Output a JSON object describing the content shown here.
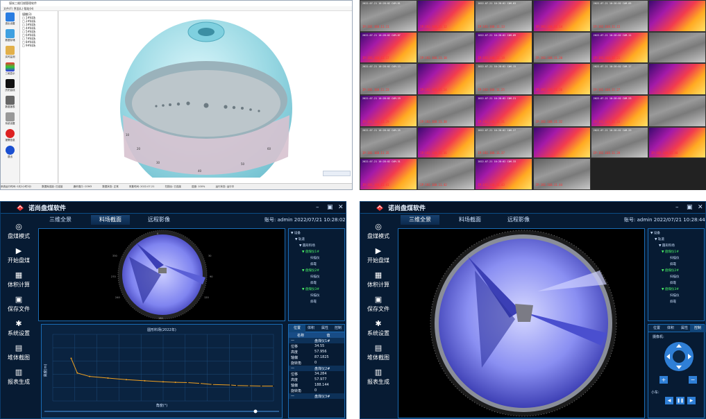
{
  "q1": {
    "window_title": "煤炭三维扫描管理软件",
    "menubar": "文件(F)  界面(L)  帮助(H)",
    "sidebar": [
      "退出设置",
      "数据存储",
      "实时监测",
      "三维显示",
      "历史曲线",
      "数据报表",
      "系统设置",
      "报警信息",
      "退出"
    ],
    "tree": [
      "煤棚(3)",
      "□ 1#料场",
      "□ 2#料场",
      "□ 3#料场",
      "□ 4#料场",
      "□ 5#料场",
      "□ 6#料场",
      "□ 7#料场",
      "□ 8#料场",
      "□ 9#料场"
    ],
    "status": [
      "系统运行时间: 0天2小时3分",
      "数据库连接: 已连接",
      "通讯端口: COM3",
      "数据状态: 正常",
      "采集时间: 2022-07-21",
      "扫描仪: 已连接",
      "进度: 100%",
      "运行状态: 运行中"
    ]
  },
  "q2": {
    "cells": [
      {
        "lab": "2022-07-21 10:28:02 CAM-01",
        "ip": "IP:192.168.11.11"
      },
      {
        "lab": "",
        "ip": "IP:192.168.11.12"
      },
      {
        "lab": "2022-07-21 10:28:02 CAM-03",
        "ip": "IP:192.168.11.13"
      },
      {
        "lab": "",
        "ip": "IP:192.168.11.14"
      },
      {
        "lab": "2022-07-21 10:28:02 CAM-05",
        "ip": "IP:192.168.11.15"
      },
      {
        "lab": "",
        "ip": ""
      },
      {
        "lab": "2022-07-21 10:28:02 CAM-07",
        "ip": "IP:192.168.11.17"
      },
      {
        "lab": "",
        "ip": "IP:192.168.11.18"
      },
      {
        "lab": "2022-07-21 10:28:02 CAM-09",
        "ip": "IP:192.168.11.19"
      },
      {
        "lab": "",
        "ip": "IP:192.168.11.20"
      },
      {
        "lab": "2022-07-21 10:28:02 CAM-11",
        "ip": "IP:192.168.11.21"
      },
      {
        "lab": "",
        "ip": ""
      },
      {
        "lab": "2022-07-21 10:28:02 CAM-13",
        "ip": "IP:192.168.11.23"
      },
      {
        "lab": "",
        "ip": "IP:192.168.11.24"
      },
      {
        "lab": "2022-07-21 10:28:02 CAM-15",
        "ip": "IP:192.168.11.25"
      },
      {
        "lab": "",
        "ip": "IP:192.168.11.26"
      },
      {
        "lab": "2022-07-21 10:28:02 CAM-17",
        "ip": "IP:192.168.11.27"
      },
      {
        "lab": "",
        "ip": ""
      },
      {
        "lab": "2022-07-21 10:28:02 CAM-19",
        "ip": "IP:192.168.11.29"
      },
      {
        "lab": "",
        "ip": "IP:192.168.11.30"
      },
      {
        "lab": "2022-07-21 10:28:02 CAM-21",
        "ip": "IP:192.168.11.31"
      },
      {
        "lab": "",
        "ip": "IP:192.168.11.32"
      },
      {
        "lab": "2022-07-21 10:28:02 CAM-23",
        "ip": "IP:192.168.11.33"
      },
      {
        "lab": "",
        "ip": ""
      },
      {
        "lab": "2022-07-21 10:28:02 CAM-25",
        "ip": "IP:192.168.11.35"
      },
      {
        "lab": "",
        "ip": "IP:192.168.11.36"
      },
      {
        "lab": "2022-07-21 10:28:02 CAM-27",
        "ip": "IP:192.168.11.37"
      },
      {
        "lab": "",
        "ip": ""
      },
      {
        "lab": "2022-07-21 10:28:02 CAM-29",
        "ip": "IP:192.168.11.39"
      },
      {
        "lab": "",
        "ip": "IP:192.168.11.40"
      },
      {
        "lab": "2022-07-21 10:28:02 CAM-31",
        "ip": "IP:192.168.11.41"
      },
      {
        "lab": "",
        "ip": "IP:192.168.11.42"
      },
      {
        "lab": "2022-07-21 10:28:02 CAM-33",
        "ip": "IP:192.168.11.43"
      },
      {
        "lab": "",
        "ip": "IP:192.168.11.44"
      }
    ]
  },
  "app": {
    "name": "诺尚盘煤软件",
    "menu": [
      "盘煤模式",
      "开始盘煤",
      "体积计算",
      "保存文件",
      "系统设置",
      "堆体截图",
      "报表生成"
    ],
    "tabs": [
      "三维全景",
      "料场截面",
      "远程影像"
    ],
    "account_left": "账号: admin 2022/07/21 10:28:02",
    "account_right": "账号: admin 2022/07/21 10:28:44",
    "tree": {
      "root": "设备",
      "l1": "轨道",
      "l2": "圆形料场",
      "groups": [
        {
          "name": "盘煤仪1#",
          "items": [
            "扫描仪",
            "斜靠"
          ]
        },
        {
          "name": "盘煤仪2#",
          "items": [
            "扫描仪",
            "斜靠"
          ]
        },
        {
          "name": "盘煤仪3#",
          "items": [
            "扫描仪",
            "斜靠"
          ]
        }
      ]
    },
    "ptabs": [
      "位置",
      "体积",
      "属性",
      "控制"
    ],
    "table_head": [
      "名称",
      "值"
    ],
    "rows": [
      {
        "k": "—",
        "v": "盘煤仪1#"
      },
      {
        "k": "位移",
        "v": "34.55"
      },
      {
        "k": "高度",
        "v": "57.956"
      },
      {
        "k": "轴偏",
        "v": "87.1825"
      },
      {
        "k": "旋转角",
        "v": "0"
      },
      {
        "k": "—",
        "v": "盘煤仪2#"
      },
      {
        "k": "位移",
        "v": "34.284"
      },
      {
        "k": "高度",
        "v": "57.977"
      },
      {
        "k": "轴偏",
        "v": "188.144"
      },
      {
        "k": "旋转角",
        "v": "0"
      },
      {
        "k": "—",
        "v": "盘煤仪3#"
      }
    ],
    "ctrl_label1": "摄像机:",
    "ctrl_label2": "小车:",
    "ctrl_plus": "+",
    "ctrl_minus": "−"
  },
  "chart_data": {
    "type": "line",
    "title": "圆形料场(2022年)",
    "xlabel": "角度(°)",
    "ylabel": "高度(m)",
    "xlim": [
      0,
      360
    ],
    "ylim": [
      0,
      25
    ],
    "x": [
      30,
      40,
      60,
      90,
      120,
      150,
      180,
      200,
      220,
      240,
      260,
      290,
      300,
      320,
      340,
      360
    ],
    "y": [
      16,
      10.5,
      9.2,
      8.6,
      8.0,
      7.6,
      7.2,
      7.0,
      6.9,
      6.6,
      6.2,
      6.0,
      5.8,
      5.7,
      5.6,
      5.6
    ],
    "grid": true
  }
}
